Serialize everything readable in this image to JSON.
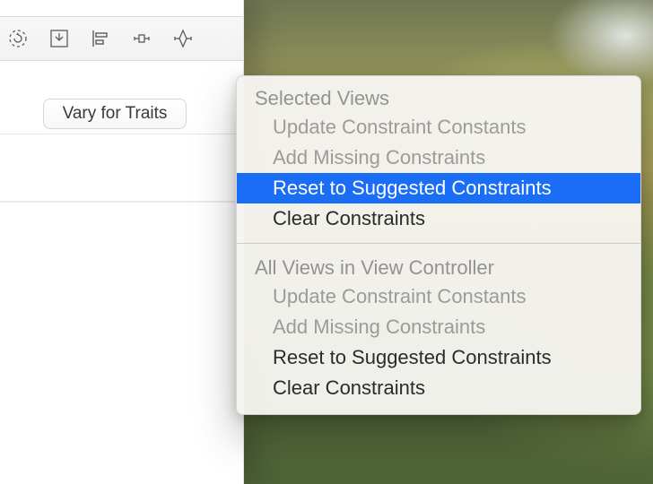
{
  "toolbar": {
    "icons": [
      "update-frames-icon",
      "embed-in-icon",
      "align-icon",
      "pin-icon",
      "resolve-issues-icon"
    ]
  },
  "vary_button_label": "Vary for Traits",
  "menu": {
    "sections": [
      {
        "header": "Selected Views",
        "items": [
          {
            "label": "Update Constraint Constants",
            "enabled": false,
            "selected": false
          },
          {
            "label": "Add Missing Constraints",
            "enabled": false,
            "selected": false
          },
          {
            "label": "Reset to Suggested Constraints",
            "enabled": true,
            "selected": true
          },
          {
            "label": "Clear Constraints",
            "enabled": true,
            "selected": false
          }
        ]
      },
      {
        "header": "All Views in View Controller",
        "items": [
          {
            "label": "Update Constraint Constants",
            "enabled": false,
            "selected": false
          },
          {
            "label": "Add Missing Constraints",
            "enabled": false,
            "selected": false
          },
          {
            "label": "Reset to Suggested Constraints",
            "enabled": true,
            "selected": false
          },
          {
            "label": "Clear Constraints",
            "enabled": true,
            "selected": false
          }
        ]
      }
    ]
  }
}
